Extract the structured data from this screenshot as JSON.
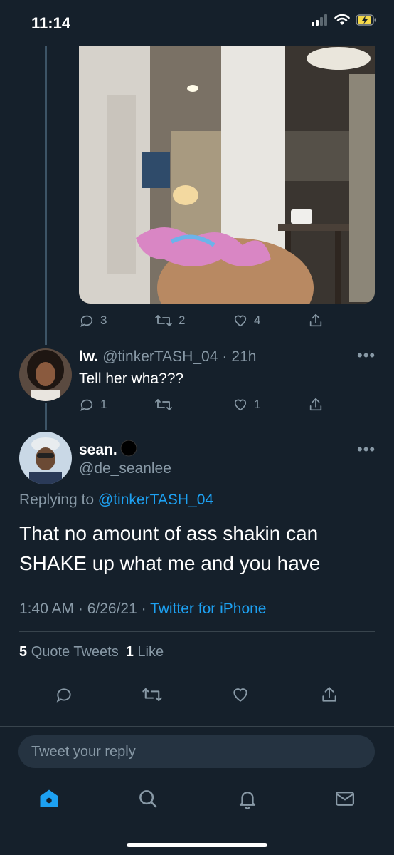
{
  "status_bar": {
    "time": "11:14"
  },
  "parent_tweet": {
    "media_icon": "video-thumbnail",
    "reply_count": "3",
    "retweet_count": "2",
    "like_count": "4"
  },
  "reply_tweet": {
    "display_name": "lw.",
    "handle": "@tinkerTASH_04",
    "separator": "·",
    "time_ago": "21h",
    "text": "Tell her wha???",
    "reply_count": "1",
    "like_count": "1"
  },
  "main_tweet": {
    "display_name": "sean.",
    "handle": "@de_seanlee",
    "replying_prefix": "Replying to",
    "replying_handle": "@tinkerTASH_04",
    "text": "That no amount of ass shakin can SHAKE up what me and you have",
    "timestamp": "1:40 AM · 6/26/21 ·",
    "source": "Twitter for iPhone",
    "quote_count": "5",
    "quote_label": "Quote Tweets",
    "like_count": "1",
    "like_label": "Like"
  },
  "composer": {
    "placeholder": "Tweet your reply"
  },
  "tabbar": {
    "items": [
      "home-icon",
      "search-icon",
      "notifications-icon",
      "messages-icon"
    ]
  },
  "colors": {
    "background": "#15202b",
    "accent": "#1da1f2",
    "muted": "#8899a6",
    "divider": "#38444d"
  }
}
